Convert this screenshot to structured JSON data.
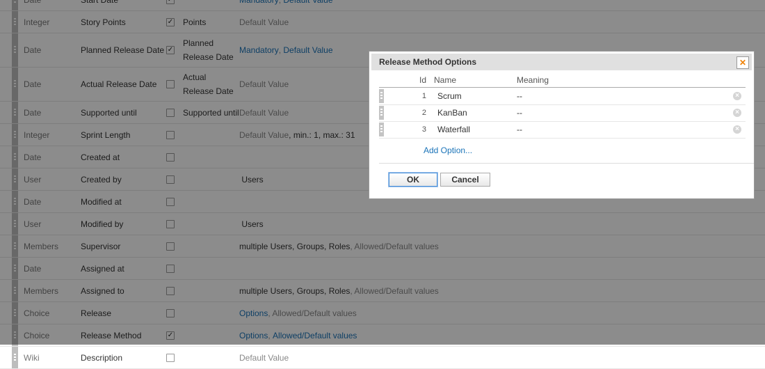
{
  "fields": [
    {
      "type": "Date",
      "name": "Start Date",
      "checked": true,
      "unit": "",
      "options": [
        {
          "text": "Mandatory",
          "style": "link"
        },
        {
          "text": ", ",
          "style": "plain"
        },
        {
          "text": "Default Value",
          "style": "link"
        }
      ],
      "tall": false
    },
    {
      "type": "Integer",
      "name": "Story Points",
      "checked": true,
      "unit": "Points",
      "options": [
        {
          "text": "Default Value",
          "style": "plain"
        }
      ],
      "tall": false
    },
    {
      "type": "Date",
      "name": "Planned Release Date",
      "checked": true,
      "unit": "Planned Release Date",
      "options": [
        {
          "text": "Mandatory",
          "style": "link"
        },
        {
          "text": ", ",
          "style": "plain"
        },
        {
          "text": "Default Value",
          "style": "link"
        }
      ],
      "tall": true
    },
    {
      "type": "Date",
      "name": "Actual Release Date",
      "checked": false,
      "unit": "Actual Release Date",
      "options": [
        {
          "text": "Default Value",
          "style": "plain"
        }
      ],
      "tall": true
    },
    {
      "type": "Date",
      "name": "Supported until",
      "checked": false,
      "unit": "Supported until",
      "options": [
        {
          "text": "Default Value",
          "style": "plain"
        }
      ],
      "tall": false
    },
    {
      "type": "Integer",
      "name": "Sprint Length",
      "checked": false,
      "unit": "",
      "options": [
        {
          "text": "Default Value",
          "style": "plain"
        },
        {
          "text": ", min.: 1, max.: 31",
          "style": "dark"
        }
      ],
      "tall": false
    },
    {
      "type": "Date",
      "name": "Created at",
      "checked": false,
      "unit": "",
      "options": [],
      "tall": false
    },
    {
      "type": "User",
      "name": "Created by",
      "checked": false,
      "unit": "",
      "options": [
        {
          "text": " Users",
          "style": "dark"
        }
      ],
      "tall": false
    },
    {
      "type": "Date",
      "name": "Modified at",
      "checked": false,
      "unit": "",
      "options": [],
      "tall": false
    },
    {
      "type": "User",
      "name": "Modified by",
      "checked": false,
      "unit": "",
      "options": [
        {
          "text": " Users",
          "style": "dark"
        }
      ],
      "tall": false
    },
    {
      "type": "Members",
      "name": "Supervisor",
      "checked": false,
      "unit": "",
      "options": [
        {
          "text": "multiple Users, Groups, Roles",
          "style": "dark"
        },
        {
          "text": ", Allowed/Default values",
          "style": "plain"
        }
      ],
      "tall": false
    },
    {
      "type": "Date",
      "name": "Assigned at",
      "checked": false,
      "unit": "",
      "options": [],
      "tall": false
    },
    {
      "type": "Members",
      "name": "Assigned to",
      "checked": false,
      "unit": "",
      "options": [
        {
          "text": "multiple Users, Groups, Roles",
          "style": "dark"
        },
        {
          "text": ", Allowed/Default values",
          "style": "plain"
        }
      ],
      "tall": false
    },
    {
      "type": "Choice",
      "name": "Release",
      "checked": false,
      "unit": "",
      "options": [
        {
          "text": "Options",
          "style": "link"
        },
        {
          "text": ", Allowed/Default values",
          "style": "plain"
        }
      ],
      "tall": false
    },
    {
      "type": "Choice",
      "name": "Release Method",
      "checked": true,
      "unit": "",
      "options": [
        {
          "text": "Options",
          "style": "link"
        },
        {
          "text": ", ",
          "style": "plain"
        },
        {
          "text": "Allowed/Default values",
          "style": "link"
        }
      ],
      "tall": false
    },
    {
      "type": "Wiki",
      "name": "Description",
      "checked": false,
      "unit": "",
      "options": [
        {
          "text": "Default Value",
          "style": "plain"
        }
      ],
      "tall": false
    }
  ],
  "dialog": {
    "title": "Release Method Options",
    "close_icon": "close-icon",
    "columns": {
      "id": "Id",
      "name": "Name",
      "meaning": "Meaning"
    },
    "options": [
      {
        "id": "1",
        "name": "Scrum",
        "meaning": "--"
      },
      {
        "id": "2",
        "name": "KanBan",
        "meaning": "--"
      },
      {
        "id": "3",
        "name": "Waterfall",
        "meaning": "--"
      }
    ],
    "add_option": "Add Option...",
    "ok_label": "OK",
    "cancel_label": "Cancel"
  },
  "colors": {
    "link": "#1a73b8",
    "close_accent": "#f08000",
    "overlay": "rgba(0,0,0,0.45)"
  }
}
